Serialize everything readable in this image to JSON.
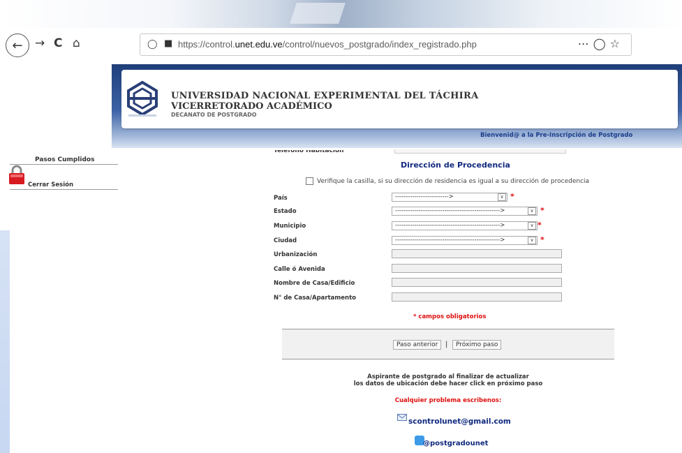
{
  "browser": {
    "url_prefix": "https://control.",
    "url_domain": "unet.edu.ve",
    "url_path": "/control/nuevos_postgrado/index_registrado.php",
    "more_icon": "⋯",
    "back_icon": "back-arrow",
    "forward_icon": "forward-arrow",
    "reload_icon": "reload",
    "home_icon": "home"
  },
  "header": {
    "line1": "UNIVERSIDAD NACIONAL EXPERIMENTAL DEL TÁCHIRA",
    "line2": "VICERRETORADO ACADÉMICO",
    "line3": "DECANATO DE POSTGRADO",
    "welcome": "Bienvenid@ a la Pre-Inscripción de Postgrado"
  },
  "sidebar": {
    "title": "Pasos Cumplidos",
    "logout": "Cerrar Sesión"
  },
  "form": {
    "cut_label": "Teléfono Habitación",
    "section_title": "Dirección de Procedencia",
    "verify_text": "Verifique la casilla, si su dirección de residencia es igual a su dirección de procedencia",
    "pais": {
      "label": "País",
      "value": "------------------------->"
    },
    "estado": {
      "label": "Estado",
      "value": "------------------------------------------------->"
    },
    "municipio": {
      "label": "Municipio",
      "value": "------------------------------------------------->"
    },
    "ciudad": {
      "label": "Ciudad",
      "value": "------------------------------------------------->"
    },
    "urbanizacion": {
      "label": "Urbanización",
      "value": ""
    },
    "calle": {
      "label": "Calle ó Avenida",
      "value": ""
    },
    "casa": {
      "label": "Nombre de Casa/Edificio",
      "value": ""
    },
    "numero": {
      "label": "N° de Casa/Apartamento",
      "value": ""
    },
    "required_mark": "*",
    "required_note": "* campos obligatorios",
    "prev_button": "Paso anterior",
    "next_button": "Próximo paso",
    "button_sep": "|"
  },
  "footer": {
    "instr1": "Aspirante de postgrado al finalizar de actualizar",
    "instr2": "los datos de ubicación debe hacer click en próximo paso",
    "problem": "Cualquier problema escribenos:",
    "email": "scontrolunet@gmail.com",
    "twitter": "@postgradounet"
  },
  "colors": {
    "title_blue": "#112a80",
    "required_red": "#e01010",
    "banner_blue": "#1f3f7a"
  }
}
